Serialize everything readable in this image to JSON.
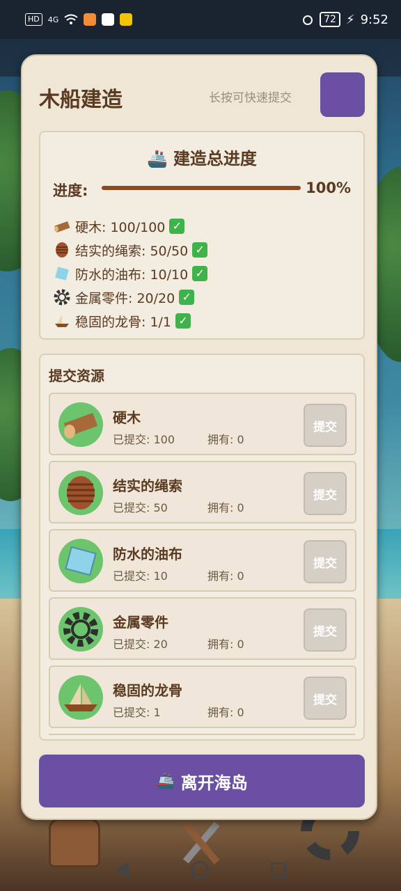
{
  "status_bar": {
    "left_chips": [
      "HD",
      "4G"
    ],
    "battery": "72",
    "time": "9:52"
  },
  "modal": {
    "title": "木船建造",
    "hint": "长按可快速提交",
    "progress_card": {
      "title": "建造总进度",
      "progress_label": "进度:",
      "progress_value": "100%",
      "progress_fraction": 1.0,
      "requirements": [
        {
          "text": "硬木: 100/100",
          "icon": "wood-log-icon"
        },
        {
          "text": "结实的绳索: 50/50",
          "icon": "rope-icon"
        },
        {
          "text": "防水的油布: 10/10",
          "icon": "tarp-icon"
        },
        {
          "text": "金属零件: 20/20",
          "icon": "gear-icon"
        },
        {
          "text": "稳固的龙骨: 1/1",
          "icon": "keel-ship-icon"
        }
      ],
      "check": "✓"
    },
    "submit_card": {
      "title": "提交资源",
      "resources": [
        {
          "name": "硬木",
          "submitted": "已提交: 100",
          "owned": "拥有: 0",
          "button": "提交",
          "icon": "wood-log-icon"
        },
        {
          "name": "结实的绳索",
          "submitted": "已提交: 50",
          "owned": "拥有: 0",
          "button": "提交",
          "icon": "rope-icon"
        },
        {
          "name": "防水的油布",
          "submitted": "已提交: 10",
          "owned": "拥有: 0",
          "button": "提交",
          "icon": "tarp-icon"
        },
        {
          "name": "金属零件",
          "submitted": "已提交: 20",
          "owned": "拥有: 0",
          "button": "提交",
          "icon": "gear-icon"
        },
        {
          "name": "稳固的龙骨",
          "submitted": "已提交: 1",
          "owned": "拥有: 0",
          "button": "提交",
          "icon": "keel-ship-icon"
        }
      ]
    },
    "leave_button": "离开海岛"
  },
  "colors": {
    "accent": "#6b4fa3",
    "title_brown": "#5a3a21",
    "progress_fill": "#8b4a20",
    "check_green": "#3fb24a",
    "icon_circle": "#6cc46c",
    "panel_bg": "#efe6d6"
  }
}
